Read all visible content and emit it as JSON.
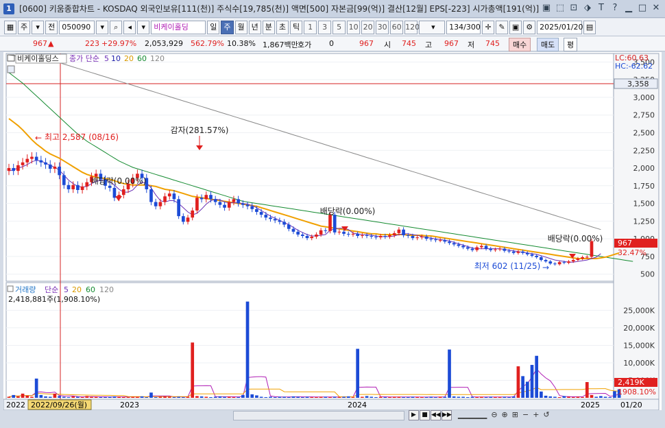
{
  "title": {
    "num": "1",
    "text": "[0600] 키움종합차트 - KOSDAQ 외국인보유[111(천)] 주식수[19,785(천)] 액면[500] 자본금[99(억)] 결산[12월] EPS[-223] 시가총액[191(억)]"
  },
  "window_icons": [
    "▣",
    "⬚",
    "⊡",
    "⬗",
    "T",
    "?",
    "▁",
    "□",
    "✕"
  ],
  "toolbar": {
    "period_type": "주",
    "prev_label": "전",
    "code": "050090",
    "stock_name": "비케이홀딩",
    "periods": [
      "일",
      "주",
      "월",
      "년",
      "분",
      "초",
      "틱"
    ],
    "selected_period": "주",
    "nums": [
      "1",
      "3",
      "5",
      "10",
      "20",
      "30",
      "60",
      "120"
    ],
    "count": "134",
    "count_total": "/300",
    "date": "2025/01/20"
  },
  "info": {
    "price": "967",
    "arrow": "▲",
    "change": "223",
    "change_pct": "+29.97%",
    "volume": "2,053,929",
    "vol_ratio": "562.79%",
    "turnover": "10.38%",
    "amount": "1,867백만",
    "hoga_label": "호가",
    "hoga_val": "0",
    "hoga_price": "967",
    "open_label": "시",
    "open": "745",
    "high_label": "고",
    "high": "967",
    "low_label": "저",
    "low": "745",
    "buy": "매수",
    "sell": "매도",
    "eval": "평"
  },
  "price_panel": {
    "legend_name": "비케이홀딩스",
    "ma_label": "종가 단순",
    "ma_periods": [
      "5",
      "10",
      "20",
      "60",
      "120"
    ],
    "ma_colors": [
      "#6a2fb5",
      "#1a1aa8",
      "#f0a000",
      "#138a2f",
      "#888888"
    ],
    "lc": "LC:60.63",
    "hc": "HC:-62.62",
    "ref_line": "3,358",
    "current": "967",
    "current_pct": "32.47%"
  },
  "volume_panel": {
    "legend_name": "거래량",
    "ma_label": "단순",
    "ma_periods": [
      "5",
      "20",
      "60",
      "120"
    ],
    "info": "2,418,881주(1,908.10%)",
    "current": "2,419K",
    "current_pct": "1908.10%"
  },
  "x_axis": {
    "labels": [
      "2022",
      "2023",
      "2024",
      "2025",
      "01/20"
    ],
    "cursor_date": "2022/09/26(월)"
  },
  "annotations": [
    {
      "text": "최고 2,587 (08/16)",
      "color": "#e0201f"
    },
    {
      "text": "감자(281.57%)",
      "color": "#222"
    },
    {
      "text": "배당락(0.00%)",
      "color": "#222"
    },
    {
      "text": "배당락(0.00%)",
      "color": "#222"
    },
    {
      "text": "배당락(0.00%)",
      "color": "#222"
    },
    {
      "text": "최저 602 (11/25)",
      "color": "#1c4bd6"
    }
  ],
  "chart_data": [
    {
      "type": "candlestick",
      "title": "",
      "y_ticks": [
        500,
        750,
        1000,
        1250,
        1500,
        1750,
        2000,
        2250,
        2500,
        2750,
        3000,
        3250,
        3500
      ],
      "y_tick_labels": [
        "500",
        "750",
        "1,000",
        "1,250",
        "1,500",
        "1,750",
        "2,000",
        "2,250",
        "2,500",
        "2,750",
        "3,000",
        "3,250",
        "3,500"
      ],
      "ylim": [
        400,
        3620
      ],
      "reference_line": 3358,
      "close": [
        2000,
        1960,
        2040,
        2080,
        2130,
        2160,
        2110,
        2080,
        2050,
        1990,
        2020,
        1900,
        1760,
        1700,
        1760,
        1690,
        1740,
        1800,
        1880,
        1920,
        1840,
        1750,
        1720,
        1580,
        1620,
        1700,
        1780,
        1860,
        1920,
        1860,
        1700,
        1520,
        1460,
        1520,
        1600,
        1640,
        1560,
        1320,
        1240,
        1300,
        1400,
        1580,
        1560,
        1620,
        1560,
        1520,
        1480,
        1440,
        1520,
        1560,
        1500,
        1480,
        1460,
        1420,
        1380,
        1340,
        1300,
        1280,
        1260,
        1240,
        1200,
        1140,
        1100,
        1060,
        1040,
        1010,
        1030,
        1060,
        1120,
        1110,
        1340,
        1090,
        1100,
        1070,
        1060,
        1070,
        1040,
        1050,
        1040,
        1030,
        1020,
        1040,
        1030,
        1050,
        1080,
        1130,
        1050,
        1040,
        1010,
        1020,
        1030,
        1000,
        990,
        980,
        980,
        960,
        940,
        920,
        900,
        880,
        860,
        840,
        880,
        900,
        860,
        840,
        850,
        860,
        830,
        820,
        800,
        820,
        800,
        780,
        760,
        740,
        700,
        680,
        650,
        640,
        670,
        660,
        680,
        700,
        720,
        740,
        745,
        967
      ],
      "ma5": [
        1960,
        1975,
        2000,
        2020,
        2050,
        2090,
        2110,
        2100,
        2070,
        2040,
        2010,
        1970,
        1900,
        1830,
        1780,
        1740,
        1730,
        1740,
        1780,
        1810,
        1830,
        1830,
        1810,
        1760,
        1700,
        1660,
        1660,
        1690,
        1760,
        1800,
        1790,
        1720,
        1620,
        1540,
        1520,
        1540,
        1540,
        1500,
        1440,
        1380,
        1340,
        1360,
        1420,
        1490,
        1540,
        1560,
        1550,
        1520,
        1510,
        1510,
        1510,
        1500,
        1490,
        1470,
        1440,
        1400,
        1360,
        1320,
        1290,
        1260,
        1230,
        1200,
        1160,
        1120,
        1090,
        1060,
        1040,
        1040,
        1050,
        1060,
        1120,
        1140,
        1150,
        1150,
        1130,
        1080,
        1070,
        1060,
        1060,
        1050,
        1040,
        1030,
        1030,
        1030,
        1040,
        1060,
        1070,
        1070,
        1060,
        1050,
        1030,
        1020,
        1010,
        1000,
        990,
        980,
        970,
        950,
        930,
        910,
        890,
        870,
        860,
        860,
        860,
        860,
        860,
        860,
        850,
        840,
        830,
        820,
        810,
        800,
        790,
        780,
        760,
        740,
        720,
        700,
        690,
        680,
        670,
        670,
        680,
        690,
        700,
        720,
        740,
        790
      ],
      "ma20": [
        2700,
        2650,
        2600,
        2540,
        2470,
        2400,
        2340,
        2290,
        2240,
        2200,
        2170,
        2140,
        2100,
        2060,
        2020,
        1980,
        1940,
        1910,
        1890,
        1870,
        1860,
        1850,
        1840,
        1820,
        1800,
        1780,
        1770,
        1760,
        1760,
        1760,
        1760,
        1750,
        1740,
        1720,
        1700,
        1690,
        1680,
        1660,
        1640,
        1620,
        1600,
        1590,
        1580,
        1570,
        1560,
        1550,
        1540,
        1530,
        1520,
        1510,
        1500,
        1490,
        1480,
        1470,
        1460,
        1440,
        1420,
        1400,
        1380,
        1360,
        1340,
        1320,
        1300,
        1280,
        1260,
        1240,
        1220,
        1200,
        1180,
        1170,
        1160,
        1150,
        1140,
        1130,
        1120,
        1110,
        1100,
        1090,
        1080,
        1070,
        1070,
        1060,
        1060,
        1060,
        1060,
        1060,
        1060,
        1050,
        1050,
        1050,
        1050,
        1040,
        1040,
        1030,
        1020,
        1010,
        1000,
        990,
        980,
        970,
        960,
        950,
        940,
        930,
        920,
        910,
        900,
        890,
        880,
        870,
        860,
        850,
        840,
        830,
        820,
        810,
        800,
        790,
        780,
        770,
        760,
        750,
        740,
        730,
        720,
        720,
        720,
        720,
        720,
        730,
        740,
        760,
        780,
        800
      ],
      "ma60": [
        3350,
        3300,
        3250,
        3200,
        3140,
        3080,
        3020,
        2960,
        2900,
        2840,
        2780,
        2720,
        2660,
        2600,
        2540,
        2480,
        2430,
        2380,
        2340,
        2300,
        2260,
        2220,
        2180,
        2140,
        2100,
        2070,
        2040,
        2010,
        1990,
        1970,
        1950,
        1930,
        1910,
        1890,
        1870,
        1850,
        1830,
        1810,
        1790,
        1770,
        1750,
        1730,
        1710,
        1690,
        1670,
        1650,
        1630,
        1610,
        1590,
        1570,
        1550,
        1530,
        1520,
        1510,
        1500,
        1490,
        1480,
        1470,
        1460,
        1450,
        1440,
        1430,
        1420,
        1410,
        1400,
        1390,
        1380,
        1370,
        1360,
        1350,
        1340,
        1330,
        1320,
        1310,
        1300,
        1290,
        1280,
        1270,
        1260,
        1250,
        1240,
        1230,
        1220,
        1210,
        1200,
        1190,
        1180,
        1170,
        1160,
        1150,
        1140,
        1130,
        1120,
        1110,
        1100,
        1090,
        1080,
        1070,
        1060,
        1050,
        1040,
        1030,
        1020,
        1010,
        1000,
        990,
        980,
        970,
        960,
        950,
        940,
        930,
        920,
        910,
        900,
        890,
        880,
        870,
        860,
        850,
        840,
        830,
        820,
        810,
        800,
        790,
        780,
        770,
        760,
        750,
        740,
        730,
        720,
        710,
        700,
        690,
        680
      ],
      "ma120": [
        3600,
        3590,
        3580,
        3570,
        3560,
        3550,
        3540,
        3530,
        3520,
        3510,
        3500,
        3490,
        3470,
        3450,
        3430,
        3410,
        3390,
        3370,
        3350,
        3330,
        3310,
        3290,
        3270,
        3250,
        3230,
        3210,
        3190,
        3170,
        3150,
        3130,
        3110,
        3090,
        3070,
        3050,
        3030,
        3010,
        2990,
        2970,
        2950,
        2930,
        2910,
        2890,
        2870,
        2850,
        2830,
        2810,
        2790,
        2770,
        2750,
        2730,
        2710,
        2690,
        2670,
        2650,
        2630,
        2610,
        2590,
        2570,
        2550,
        2530,
        2510,
        2490,
        2470,
        2450,
        2430,
        2410,
        2390,
        2370,
        2350,
        2330,
        2310,
        2290,
        2270,
        2250,
        2230,
        2210,
        2190,
        2170,
        2150,
        2130,
        2110,
        2090,
        2070,
        2050,
        2030,
        2010,
        1990,
        1970,
        1950,
        1930,
        1910,
        1890,
        1870,
        1850,
        1830,
        1810,
        1790,
        1770,
        1750,
        1730,
        1710,
        1690,
        1670,
        1650,
        1630,
        1610,
        1590,
        1570,
        1550,
        1530,
        1510,
        1490,
        1470,
        1450,
        1430,
        1410,
        1390,
        1370,
        1350,
        1330,
        1310,
        1290,
        1270,
        1250,
        1230,
        1210,
        1190,
        1170,
        1150,
        1130
      ]
    },
    {
      "type": "bar",
      "title": "",
      "y_ticks": [
        5000,
        10000,
        15000,
        20000,
        25000
      ],
      "y_tick_labels": [
        "5,000K",
        "10,000K",
        "15,000K",
        "20,000K",
        "25,000K"
      ],
      "ylim": [
        0,
        29000
      ],
      "values": [
        300,
        800,
        400,
        1200,
        600,
        300,
        5500,
        800,
        400,
        300,
        1200,
        500,
        300,
        200,
        400,
        300,
        200,
        500,
        300,
        300,
        200,
        200,
        300,
        400,
        300,
        200,
        200,
        300,
        300,
        400,
        200,
        1500,
        200,
        300,
        400,
        300,
        200,
        300,
        200,
        300,
        15800,
        500,
        400,
        300,
        200,
        300,
        400,
        300,
        300,
        200,
        200,
        800,
        27500,
        1000,
        700,
        300,
        200,
        300,
        200,
        300,
        300,
        200,
        400,
        300,
        200,
        300,
        200,
        200,
        300,
        300,
        200,
        300,
        200,
        300,
        400,
        200,
        14000,
        300,
        500,
        300,
        200,
        300,
        200,
        200,
        300,
        300,
        200,
        200,
        300,
        200,
        200,
        200,
        300,
        200,
        300,
        300,
        13800,
        400,
        300,
        300,
        200,
        300,
        200,
        300,
        200,
        300,
        200,
        200,
        300,
        200,
        400,
        9000,
        6200,
        4600,
        9400,
        12000,
        1800,
        600,
        400,
        300,
        200,
        500,
        300,
        200,
        300,
        200,
        4500,
        800,
        300,
        500,
        300,
        200,
        1900,
        2419
      ]
    }
  ]
}
